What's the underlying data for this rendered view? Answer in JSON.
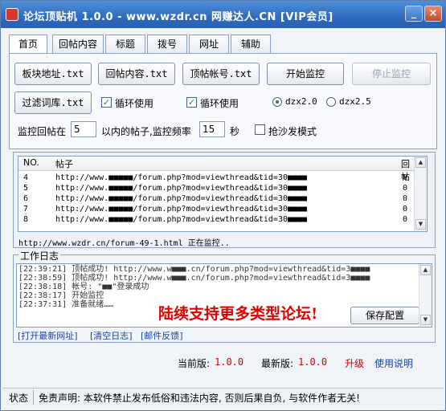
{
  "window": {
    "title": "论坛顶贴机 1.0.0 - www.wzdr.cn 网赚达人.CN [VIP会员]",
    "minimize": "_",
    "close": "×"
  },
  "tabs": [
    "首页",
    "回帖内容",
    "标题",
    "拨号",
    "网址",
    "辅助"
  ],
  "buttons": {
    "board_address": "板块地址.txt",
    "reply_content": "回帖内容.txt",
    "post_account": "顶帖帐号.txt",
    "start_monitor": "开始监控",
    "stop_monitor": "停止监控",
    "filter_words": "过滤词库.txt",
    "save_config": "保存配置"
  },
  "options": {
    "loop_use_1": "循环使用",
    "loop_use_2": "循环使用",
    "dzx20": "dzx2.0",
    "dzx25": "dzx2.5",
    "sofa_mode": "抢沙发模式"
  },
  "monitor": {
    "prefix": "监控回帖在",
    "posts_within": "5",
    "middle": "以内的帖子,监控频率",
    "frequency": "15",
    "suffix": "秒"
  },
  "list": {
    "headers": [
      "NO.",
      "帖子",
      "回帖"
    ],
    "rows": [
      {
        "no": "4",
        "post": "http://www.■■■■■/forum.php?mod=viewthread&tid=30■■■■",
        "replies": "0"
      },
      {
        "no": "5",
        "post": "http://www.■■■■■/forum.php?mod=viewthread&tid=30■■■■",
        "replies": "0"
      },
      {
        "no": "6",
        "post": "http://www.■■■■■/forum.php?mod=viewthread&tid=30■■■■",
        "replies": "0"
      },
      {
        "no": "7",
        "post": "http://www.■■■■■/forum.php?mod=viewthread&tid=30■■■■",
        "replies": "0"
      },
      {
        "no": "8",
        "post": "http://www.■■■■■/forum.php?mod=viewthread&tid=30■■■■",
        "replies": "0"
      }
    ]
  },
  "status_url": "http://www.wzdr.cn/forum-49-1.html 正在监控..",
  "log": {
    "legend": "工作日志",
    "lines": [
      "[22:39:21] 顶帖成功!  http://www.w■■■.cn/forum.php?mod=viewthread&tid=3■■■■",
      "[22:38:59] 顶帖成功!  http://www.w■■■.cn/forum.php?mod=viewthread&tid=3■■■■",
      "[22:38:18] 帐号: \"■■\"登录成功",
      "[22:38:17] 开始监控",
      "[22:37:31] 准备就绪……"
    ],
    "promo": "陆续支持更多类型论坛!",
    "links": [
      "[打开最新网址]",
      "[清空日志]",
      "[邮件反馈]"
    ]
  },
  "version": {
    "current_label": "当前版:",
    "current": "1.0.0",
    "latest_label": "最新版:",
    "latest": "1.0.0",
    "upgrade": "升级",
    "help": "使用说明"
  },
  "statusbar": {
    "state": "状态",
    "disclaimer": "免责声明: 本软件禁止发布低俗和违法内容, 否则后果自负, 与软件作者无关!"
  }
}
